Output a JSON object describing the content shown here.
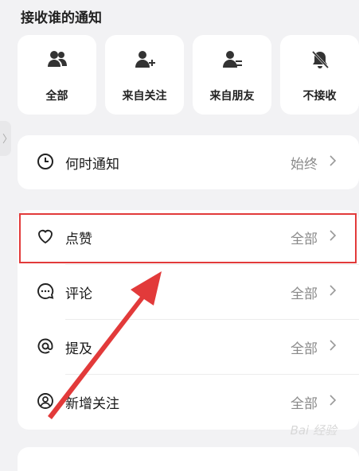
{
  "section_title": "接收谁的通知",
  "filters": [
    {
      "label": "全部",
      "icon": "group-icon"
    },
    {
      "label": "来自关注",
      "icon": "person-add-icon"
    },
    {
      "label": "来自朋友",
      "icon": "person-swap-icon"
    },
    {
      "label": "不接收",
      "icon": "bell-off-icon"
    }
  ],
  "timing": {
    "label": "何时通知",
    "value": "始终",
    "icon": "clock-icon"
  },
  "settings": [
    {
      "label": "点赞",
      "value": "全部",
      "icon": "heart-icon"
    },
    {
      "label": "评论",
      "value": "全部",
      "icon": "comment-icon"
    },
    {
      "label": "提及",
      "value": "全部",
      "icon": "at-icon"
    },
    {
      "label": "新增关注",
      "value": "全部",
      "icon": "new-follower-icon"
    }
  ],
  "side_handle_glyph": "〉",
  "watermark": "Bai 经验",
  "colors": {
    "highlight": "#e23a3a",
    "arrow": "#e23a3a",
    "value_text": "#8a8a8a"
  }
}
